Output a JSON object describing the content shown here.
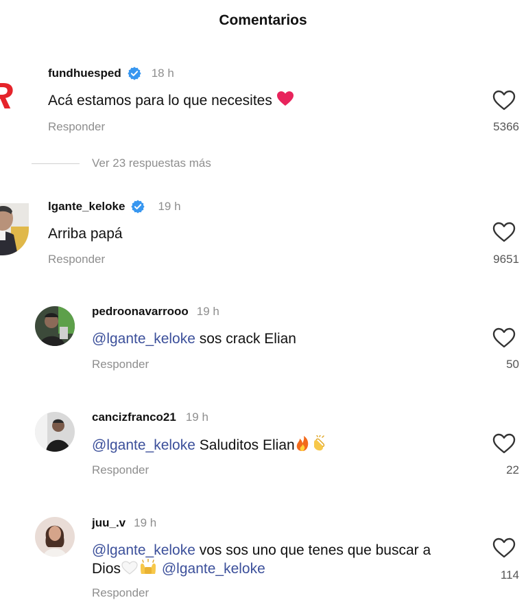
{
  "header": {
    "title": "Comentarios"
  },
  "reply_label": "Responder",
  "comments": [
    {
      "username": "fundhuesped",
      "verified": true,
      "time": "18 h",
      "text": "Acá estamos para lo que necesites",
      "emoji": "red-heart",
      "likes": "5366",
      "more_replies": "Ver 23 respuestas más"
    },
    {
      "username": "lgante_keloke",
      "verified": true,
      "time": "19 h",
      "text": "Arriba papá",
      "likes": "9651"
    },
    {
      "username": "pedroonavarrooo",
      "time": "19 h",
      "mention": "@lgante_keloke",
      "text": " sos crack Elian",
      "likes": "50"
    },
    {
      "username": "cancizfranco21",
      "time": "19 h",
      "mention": "@lgante_keloke",
      "text": " Saluditos Elian",
      "emojis": [
        "fire",
        "clapping-hands"
      ],
      "likes": "22"
    },
    {
      "username": "juu_.v",
      "time": "19 h",
      "mention": "@lgante_keloke",
      "text_line1": " vos sos uno que tenes que buscar a",
      "text_line2_prefix": "Dios",
      "emojis": [
        "white-heart",
        "raising-hands"
      ],
      "mention2": " @lgante_keloke",
      "likes": "114"
    }
  ],
  "colors": {
    "mention": "#3b4f9a",
    "verified": "#3897f0",
    "secondary_text": "#8e8e8e"
  }
}
